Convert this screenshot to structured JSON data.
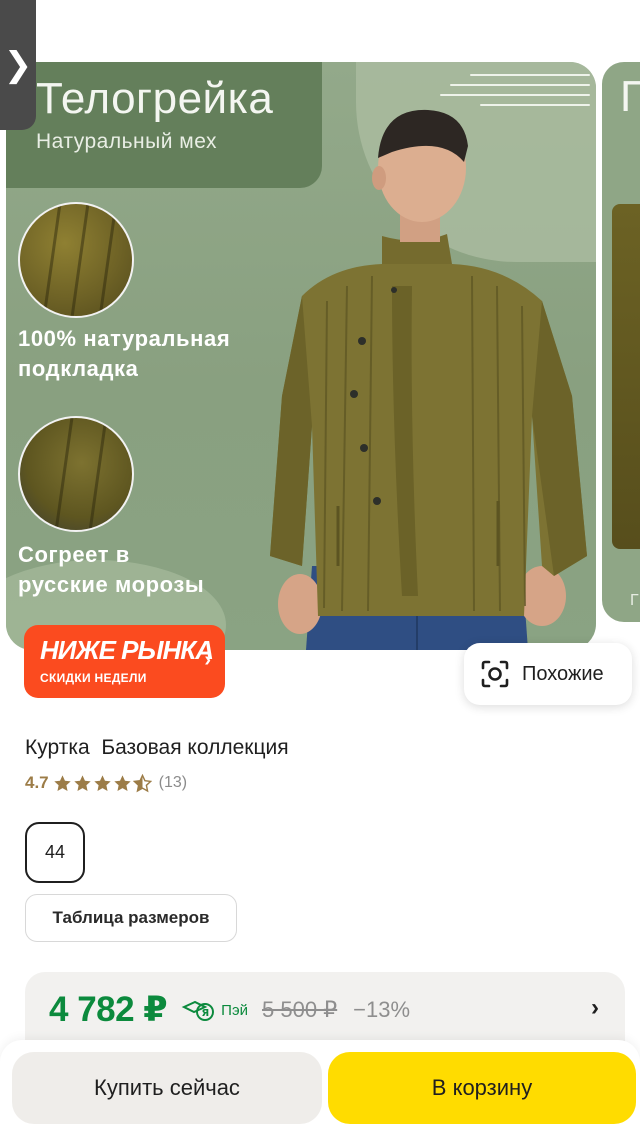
{
  "gallery": {
    "card_title": "Телогрейка",
    "card_subtitle": "Натуральный мех",
    "feature_1": [
      "100% натуральная",
      "подкладка"
    ],
    "feature_2": [
      "Согреет в",
      "русские морозы"
    ],
    "next_card_title_fragment": "П",
    "next_card_small": "Г",
    "back_icon": "chevron-right-icon"
  },
  "promo": {
    "title": "НИЖЕ РЫНКА",
    "subtitle": "СКИДКИ НЕДЕЛИ",
    "arrow": "›",
    "color": "#fb4b1f"
  },
  "similar_button": {
    "label": "Похожие",
    "icon": "lens-icon"
  },
  "product": {
    "title": "Куртка  Базовая коллекция",
    "rating_value": "4.7",
    "rating": 4.7,
    "rating_max": 5,
    "reviews_count": "(13)"
  },
  "size": {
    "selected": "44",
    "size_table_label": "Таблица размеров"
  },
  "price": {
    "current": "4 782 ₽",
    "pay_label": "Пэй",
    "old": "5 500 ₽",
    "discount": "−13%",
    "accent_color": "#0c8a3d",
    "arrow": "›"
  },
  "actions": {
    "buy_now": "Купить сейчас",
    "add_to_cart": "В корзину",
    "cart_color": "#ffdc00"
  }
}
